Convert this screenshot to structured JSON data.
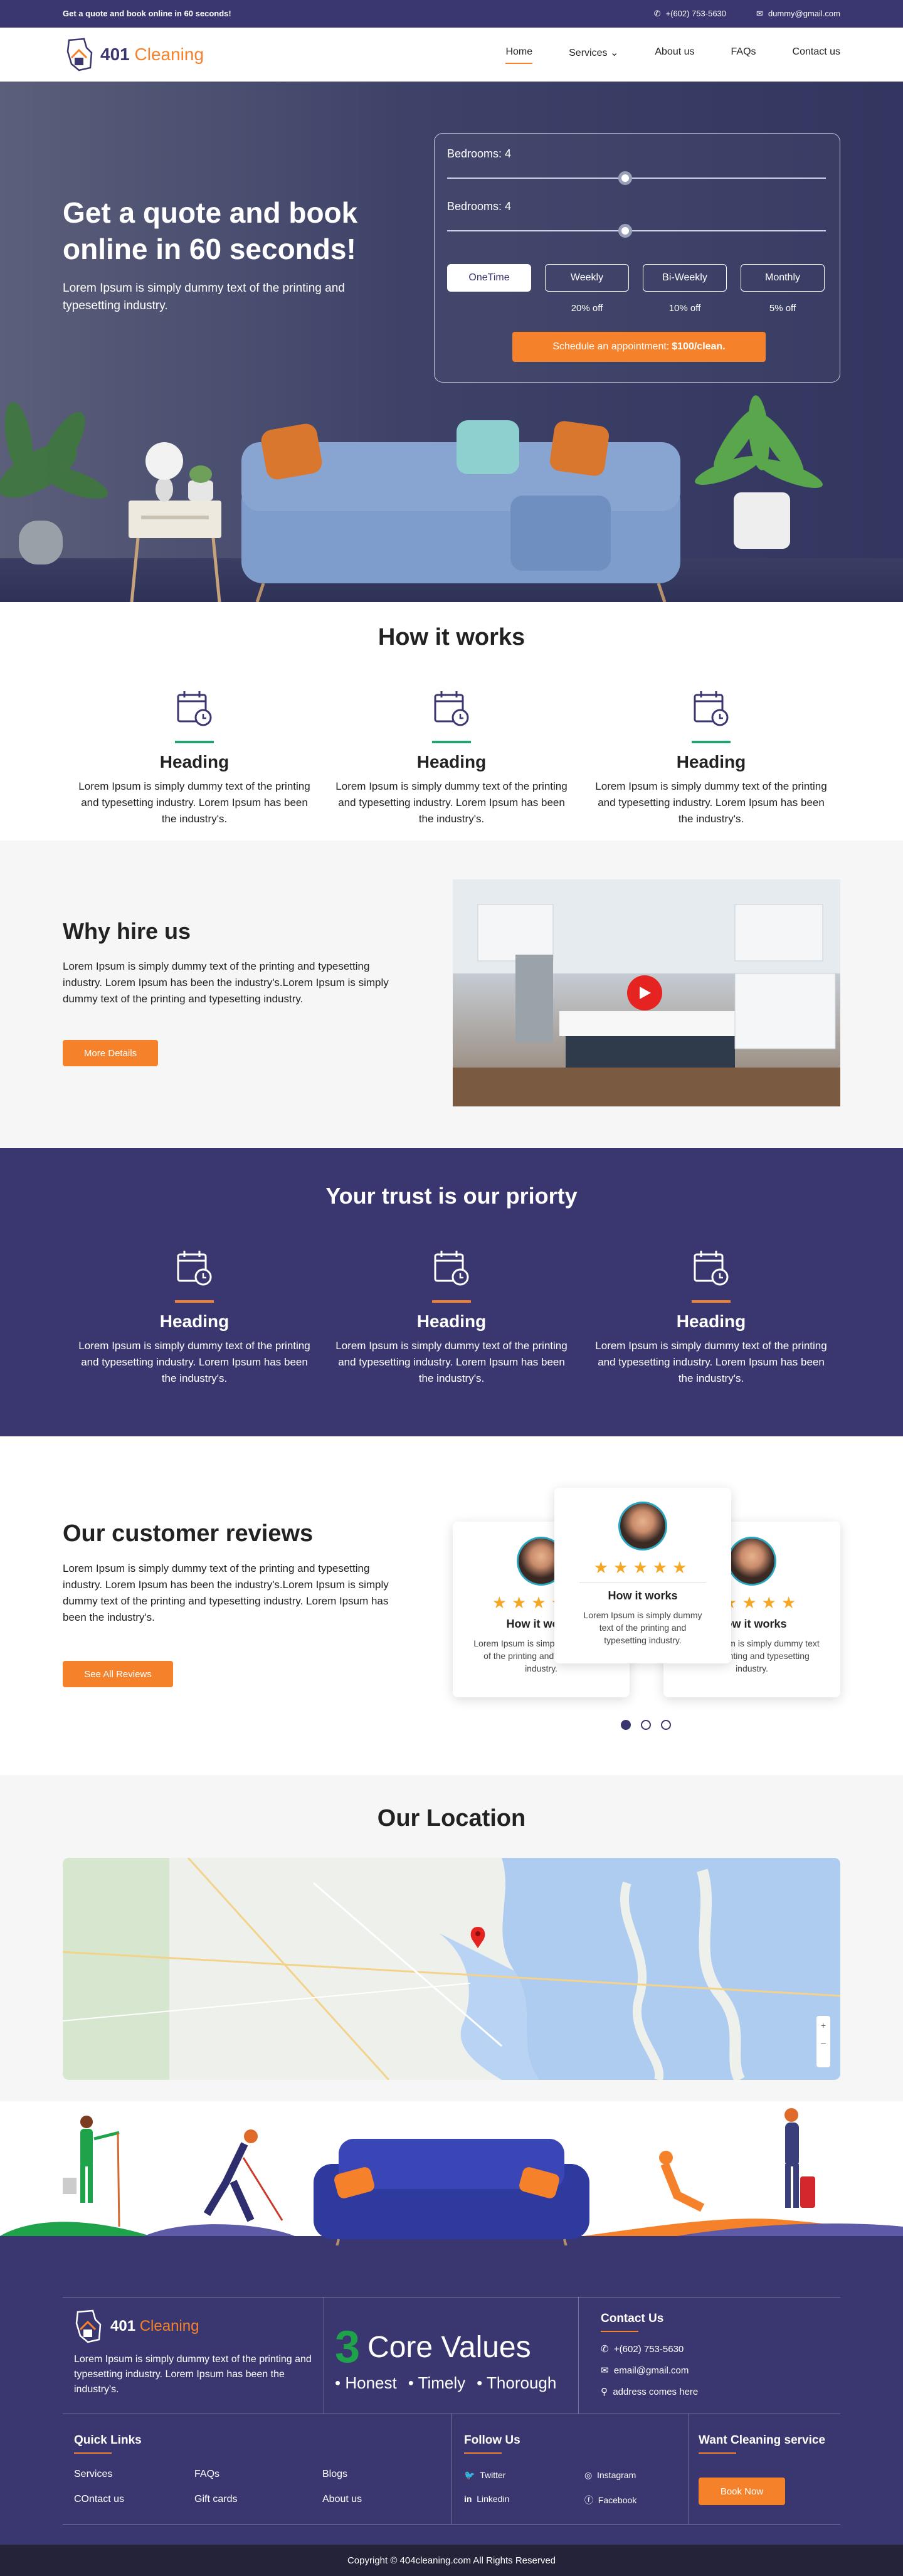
{
  "topbar": {
    "tagline": "Get a quote and book online in 60 seconds!",
    "phone": "+(602) 753-5630",
    "email": "dummy@gmail.com"
  },
  "brand": {
    "name": "401",
    "name_accent": "Cleaning"
  },
  "nav": {
    "items": [
      "Home",
      "Services",
      "About us",
      "FAQs",
      "Contact us"
    ],
    "active": "Home"
  },
  "hero": {
    "title": "Get a quote and book online in 60 seconds!",
    "subtitle": "Lorem Ipsum is simply dummy text of the printing and typesetting industry.",
    "bedrooms_label_1": "Bedrooms: 4",
    "bedrooms_label_2": "Bedrooms: 4",
    "slider_level": 0.47,
    "frequencies": [
      {
        "label": "OneTime",
        "discount": ""
      },
      {
        "label": "Weekly",
        "discount": "20% off"
      },
      {
        "label": "Bi-Weekly",
        "discount": "10% off"
      },
      {
        "label": "Monthly",
        "discount": "5% off"
      }
    ],
    "selected_frequency": "OneTime",
    "cta_label": "Schedule an appointment:",
    "cta_price": "$100/clean."
  },
  "how": {
    "title": "How it works",
    "items": [
      {
        "heading": "Heading",
        "text": "Lorem Ipsum is simply dummy text of the printing and typesetting industry. Lorem Ipsum has been the industry's."
      },
      {
        "heading": "Heading",
        "text": "Lorem Ipsum is simply dummy text of the printing and typesetting industry. Lorem Ipsum has been the industry's."
      },
      {
        "heading": "Heading",
        "text": "Lorem Ipsum is simply dummy text of the printing and typesetting industry. Lorem Ipsum has been the industry's."
      }
    ]
  },
  "why": {
    "title": "Why hire us",
    "text": "Lorem Ipsum is simply dummy text of the printing and typesetting industry. Lorem Ipsum has been the industry's.Lorem Ipsum is simply dummy text of the printing and typesetting industry.",
    "button": "More Details"
  },
  "trust": {
    "title": "Your trust is our priorty",
    "items": [
      {
        "heading": "Heading",
        "text": "Lorem Ipsum is simply dummy text of the printing and typesetting industry. Lorem Ipsum has been the industry's."
      },
      {
        "heading": "Heading",
        "text": "Lorem Ipsum is simply dummy text of the printing and typesetting industry. Lorem Ipsum has been the industry's."
      },
      {
        "heading": "Heading",
        "text": "Lorem Ipsum is simply dummy text of the printing and typesetting industry. Lorem Ipsum has been the industry's."
      }
    ]
  },
  "reviews": {
    "title": "Our customer reviews",
    "text": "Lorem Ipsum is simply dummy text of the printing and typesetting industry. Lorem Ipsum has been the industry's.Lorem Ipsum is simply dummy text of the printing and typesetting industry. Lorem Ipsum has been the industry's.",
    "button": "See All Reviews",
    "card_title": "How it works",
    "card_text": "Lorem Ipsum is simply dummy text of the printing and typesetting industry.",
    "rating": 5,
    "pages": 3,
    "active_page": 1
  },
  "location": {
    "title": "Our Location"
  },
  "footer": {
    "about": "Lorem Ipsum is simply dummy text of the printing and typesetting industry. Lorem Ipsum has been the industry's.",
    "core_num": "3",
    "core_title": "Core Values",
    "values": [
      "Honest",
      "Timely",
      "Thorough"
    ],
    "contact_title": "Contact Us",
    "contact_phone": "+(602) 753-5630",
    "contact_email": "email@gmail.com",
    "contact_address": "address comes here",
    "quick_title": "Quick Links",
    "quick_links": [
      "Services",
      "FAQs",
      "Blogs",
      "COntact us",
      "Gift cards",
      "About us"
    ],
    "follow_title": "Follow Us",
    "social": [
      "Twitter",
      "Instagram",
      "Linkedin",
      "Facebook"
    ],
    "want_title": "Want Cleaning service",
    "book_button": "Book Now",
    "copyright": "Copyright © 404cleaning.com All Rights Reserved"
  },
  "colors": {
    "primary": "#3a3670",
    "accent": "#f5822a",
    "green": "#21a46b"
  }
}
